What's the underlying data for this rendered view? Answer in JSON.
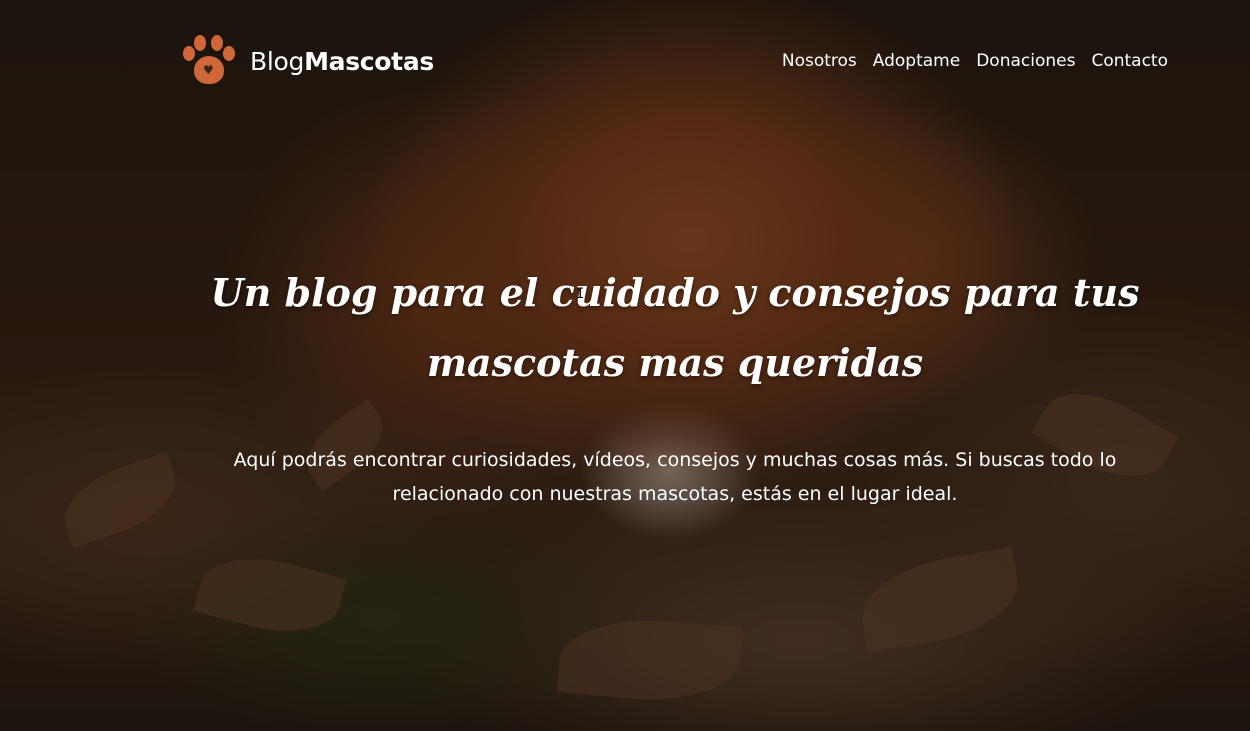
{
  "brand": {
    "name_light": "Blog",
    "name_bold": "Mascotas",
    "logo_icon": "paw-heart-icon",
    "accent_color": "#d0673a"
  },
  "nav": {
    "items": [
      {
        "label": "Nosotros"
      },
      {
        "label": "Adoptame"
      },
      {
        "label": "Donaciones"
      },
      {
        "label": "Contacto"
      }
    ]
  },
  "hero": {
    "title": "Un blog para el cuidado y consejos para tus mascotas mas queridas",
    "subtitle": "Aquí podrás encontrar curiosidades, vídeos, consejos y muchas cosas más. Si buscas todo lo relacionado con nuestras mascotas, estás en el lugar ideal."
  }
}
